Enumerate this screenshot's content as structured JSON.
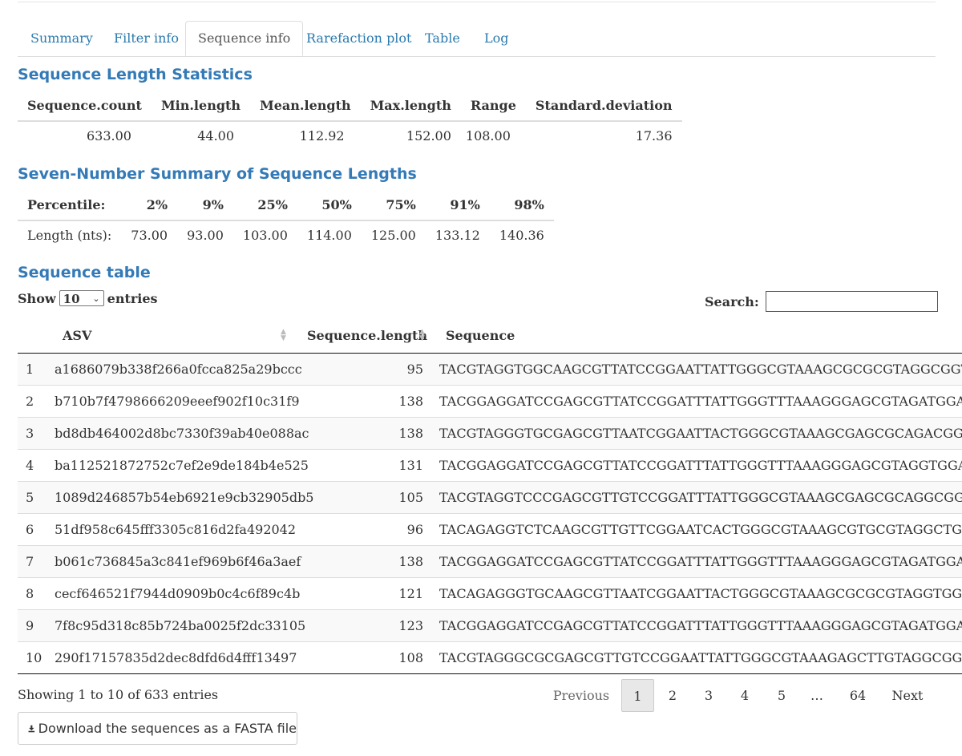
{
  "tabs": [
    {
      "label": "Summary"
    },
    {
      "label": "Filter info"
    },
    {
      "label": "Sequence info"
    },
    {
      "label": "Rarefaction plot"
    },
    {
      "label": "Table"
    },
    {
      "label": "Log"
    }
  ],
  "active_tab": "Sequence info",
  "length_stats": {
    "title": "Sequence Length Statistics",
    "headers": [
      "Sequence.count",
      "Min.length",
      "Mean.length",
      "Max.length",
      "Range",
      "Standard.deviation"
    ],
    "values": [
      "633.00",
      "44.00",
      "112.92",
      "152.00",
      "108.00",
      "17.36"
    ]
  },
  "seven_number": {
    "title": "Seven-Number Summary of Sequence Lengths",
    "headers": [
      "Percentile:",
      "2%",
      "9%",
      "25%",
      "50%",
      "75%",
      "91%",
      "98%"
    ],
    "values": [
      "Length (nts):",
      "73.00",
      "93.00",
      "103.00",
      "114.00",
      "125.00",
      "133.12",
      "140.36"
    ]
  },
  "sequence_table": {
    "title": "Sequence table",
    "show_label": "Show",
    "entries_label": "entries",
    "page_size": "10",
    "search_label": "Search:",
    "search_value": "",
    "columns": [
      "ASV",
      "Sequence.length",
      "Sequence"
    ],
    "rows": [
      {
        "idx": "1",
        "asv": "a1686079b338f266a0fcca825a29bccc",
        "len": "95",
        "seq": "TACGTAGGTGGCAAGCGTTATCCGGAATTATTGGGCGTAAAGCGCGCGTAGGCGGTTTTTT"
      },
      {
        "idx": "2",
        "asv": "b710b7f4798666209eeef902f10c31f9",
        "len": "138",
        "seq": "TACGGAGGATCCGAGCGTTATCCGGATTTATTGGGTTTAAAGGGAGCGTAGATGGATGTT"
      },
      {
        "idx": "3",
        "asv": "bd8db464002d8bc7330f39ab40e088ac",
        "len": "138",
        "seq": "TACGTAGGGTGCGAGCGTTAATCGGAATTACTGGGCGTAAAGCGAGCGCAGACGGTTACT"
      },
      {
        "idx": "4",
        "asv": "ba112521872752c7ef2e9de184b4e525",
        "len": "131",
        "seq": "TACGGAGGATCCGAGCGTTATCCGGATTTATTGGGTTTAAAGGGAGCGTAGGTGGATTGT"
      },
      {
        "idx": "5",
        "asv": "1089d246857b54eb6921e9cb32905db5",
        "len": "105",
        "seq": "TACGTAGGTCCCGAGCGTTGTCCGGATTTATTGGGCGTAAAGCGAGCGCAGGCGGTTAGA"
      },
      {
        "idx": "6",
        "asv": "51df958c645fff3305c816d2fa492042",
        "len": "96",
        "seq": "TACAGAGGTCTCAAGCGTTGTTCGGAATCACTGGGCGTAAAGCGTGCGTAGGCTGTTTCGT"
      },
      {
        "idx": "7",
        "asv": "b061c736845a3c841ef969b6f46a3aef",
        "len": "138",
        "seq": "TACGGAGGATCCGAGCGTTATCCGGATTTATTGGGTTTAAAGGGAGCGTAGATGGATGTT"
      },
      {
        "idx": "8",
        "asv": "cecf646521f7944d0909b0c4c6f89c4b",
        "len": "121",
        "seq": "TACAGAGGGTGCAAGCGTTAATCGGAATTACTGGGCGTAAAGCGCGCGTAGGTGGTTTGT"
      },
      {
        "idx": "9",
        "asv": "7f8c95d318c85b724ba0025f2dc33105",
        "len": "123",
        "seq": "TACGGAGGATCCGAGCGTTATCCGGATTTATTGGGTTTAAAGGGAGCGTAGATGGATGTT"
      },
      {
        "idx": "10",
        "asv": "290f17157835d2dec8dfd6d4fff13497",
        "len": "108",
        "seq": "TACGTAGGGCGCGAGCGTTGTCCGGAATTATTGGGCGTAAAGAGCTTGTAGGCGGTTTGTC"
      }
    ],
    "info": "Showing 1 to 10 of 633 entries",
    "pagination": {
      "previous": "Previous",
      "pages": [
        "1",
        "2",
        "3",
        "4",
        "5",
        "…",
        "64"
      ],
      "current": "1",
      "next": "Next"
    }
  },
  "download_label": "Download the sequences as a FASTA file"
}
